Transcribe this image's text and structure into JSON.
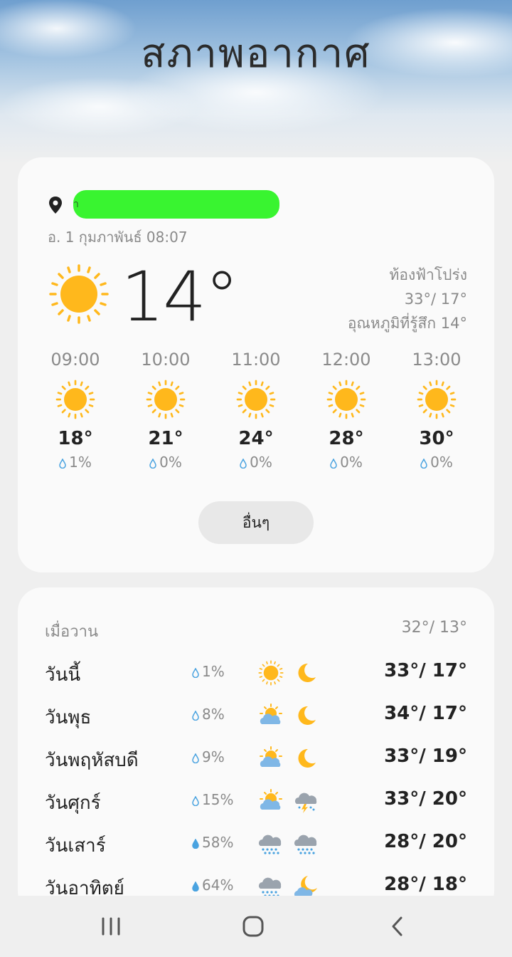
{
  "page": {
    "title": "สภาพอากาศ"
  },
  "current": {
    "location": "ำ",
    "datetime": "อ. 1 กุมภาพันธ์ 08:07",
    "icon": "sun-icon",
    "temp": "14°",
    "condition": "ท้องฟ้าโปร่ง",
    "high_low": "33°/ 17°",
    "feels_like": "อุณหภูมิที่รู้สึก 14°"
  },
  "hourly": [
    {
      "time": "09:00",
      "icon": "sun-icon",
      "temp": "18°",
      "precip": "1%"
    },
    {
      "time": "10:00",
      "icon": "sun-icon",
      "temp": "21°",
      "precip": "0%"
    },
    {
      "time": "11:00",
      "icon": "sun-icon",
      "temp": "24°",
      "precip": "0%"
    },
    {
      "time": "12:00",
      "icon": "sun-icon",
      "temp": "28°",
      "precip": "0%"
    },
    {
      "time": "13:00",
      "icon": "sun-icon",
      "temp": "30°",
      "precip": "0%"
    }
  ],
  "more_button": "อื่นๆ",
  "yesterday": {
    "label": "เมื่อวาน",
    "temps": "32°/ 13°"
  },
  "daily": [
    {
      "day": "วันนี้",
      "precip": "1%",
      "day_icon": "sun-icon",
      "night_icon": "moon-icon",
      "temps": "33°/ 17°"
    },
    {
      "day": "วันพุธ",
      "precip": "8%",
      "day_icon": "partly-cloudy-icon",
      "night_icon": "moon-icon",
      "temps": "34°/ 17°"
    },
    {
      "day": "วันพฤหัสบดี",
      "precip": "9%",
      "day_icon": "partly-cloudy-icon",
      "night_icon": "moon-icon",
      "temps": "33°/ 19°"
    },
    {
      "day": "วันศุกร์",
      "precip": "15%",
      "day_icon": "partly-cloudy-icon",
      "night_icon": "thunderstorm-icon",
      "temps": "33°/ 20°"
    },
    {
      "day": "วันเสาร์",
      "precip": "58%",
      "day_icon": "rain-cloud-icon",
      "night_icon": "rain-cloud-icon",
      "temps": "28°/ 20°"
    },
    {
      "day": "วันอาทิตย์",
      "precip": "64%",
      "day_icon": "rain-cloud-icon",
      "night_icon": "moon-cloud-icon",
      "temps": "28°/ 18°"
    }
  ],
  "nav": {
    "recent": "recents-icon",
    "home": "home-icon",
    "back": "back-icon"
  },
  "colors": {
    "sun": "#FFB81C",
    "rain_drop": "#4aa3e0",
    "card": "#fafafa",
    "background": "#efefef"
  }
}
